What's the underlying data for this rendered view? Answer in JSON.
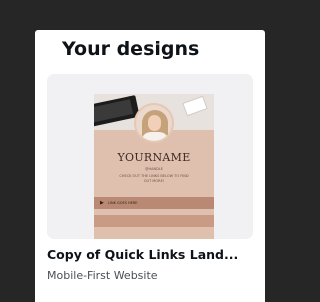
{
  "section": {
    "title": "Your designs"
  },
  "card": {
    "title": "Copy of Quick Links Land...",
    "subtitle": "Mobile-First Website",
    "preview": {
      "name": "YOURNAME",
      "handle": "@HANDLE",
      "tagline": "CHECK OUT THE LINKS BELOW TO FIND OUT MORE!",
      "link_label": "LINK GOES HERE",
      "link_arrow": "▶"
    }
  },
  "colors": {
    "background": "#262626",
    "panel": "#ffffff",
    "thumbnail_bg": "#f1f1f3",
    "preview_bg": "#dfbfae",
    "link_bar": "#b98973"
  }
}
